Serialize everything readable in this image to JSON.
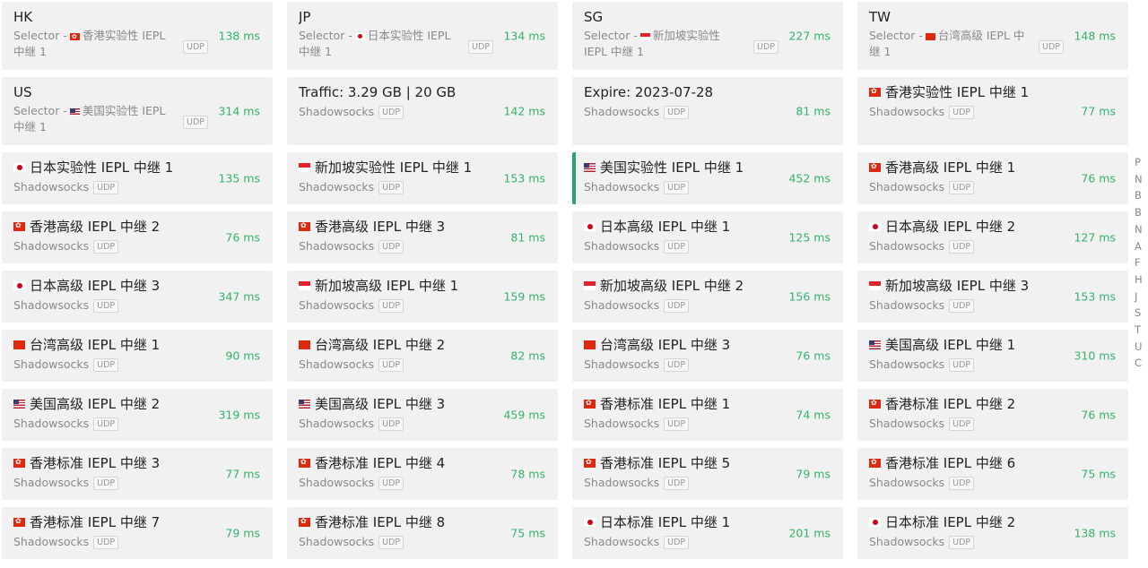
{
  "proxies": [
    {
      "kind": "selector",
      "title": "HK",
      "flag": "hk",
      "selector_prefix": "Selector -",
      "selector_value": "香港实验性 IEPL 中继 1",
      "tag": "UDP",
      "latency": "138 ms"
    },
    {
      "kind": "selector",
      "title": "JP",
      "flag": "jp",
      "selector_prefix": "Selector -",
      "selector_value": "日本实验性 IEPL 中继 1",
      "tag": "UDP",
      "latency": "134 ms"
    },
    {
      "kind": "selector",
      "title": "SG",
      "flag": "sg",
      "selector_prefix": "Selector -",
      "selector_value": "新加坡实验性 IEPL 中继 1",
      "tag": "UDP",
      "latency": "227 ms"
    },
    {
      "kind": "selector",
      "title": "TW",
      "flag": "tw",
      "selector_prefix": "Selector -",
      "selector_value": "台湾高级 IEPL 中继 1",
      "tag": "UDP",
      "latency": "148 ms"
    },
    {
      "kind": "selector",
      "title": "US",
      "flag": "us",
      "selector_prefix": "Selector -",
      "selector_value": "美国实验性 IEPL 中继 1",
      "tag": "UDP",
      "latency": "314 ms"
    },
    {
      "kind": "proxy",
      "title": "Traffic: 3.29 GB | 20 GB",
      "flag": "",
      "type": "Shadowsocks",
      "tag": "UDP",
      "latency": "142 ms"
    },
    {
      "kind": "proxy",
      "title": "Expire: 2023-07-28",
      "flag": "",
      "type": "Shadowsocks",
      "tag": "UDP",
      "latency": "81 ms"
    },
    {
      "kind": "proxy",
      "title": "香港实验性 IEPL 中继 1",
      "flag": "hk",
      "type": "Shadowsocks",
      "tag": "UDP",
      "latency": "77 ms"
    },
    {
      "kind": "proxy",
      "title": "日本实验性 IEPL 中继 1",
      "flag": "jp",
      "type": "Shadowsocks",
      "tag": "UDP",
      "latency": "135 ms"
    },
    {
      "kind": "proxy",
      "title": "新加坡实验性 IEPL 中继 1",
      "flag": "sg",
      "type": "Shadowsocks",
      "tag": "UDP",
      "latency": "153 ms"
    },
    {
      "kind": "proxy",
      "title": "美国实验性 IEPL 中继 1",
      "flag": "us",
      "type": "Shadowsocks",
      "tag": "UDP",
      "latency": "452 ms",
      "active": true
    },
    {
      "kind": "proxy",
      "title": "香港高级 IEPL 中继 1",
      "flag": "hk",
      "type": "Shadowsocks",
      "tag": "UDP",
      "latency": "76 ms"
    },
    {
      "kind": "proxy",
      "title": "香港高级 IEPL 中继 2",
      "flag": "hk",
      "type": "Shadowsocks",
      "tag": "UDP",
      "latency": "76 ms"
    },
    {
      "kind": "proxy",
      "title": "香港高级 IEPL 中继 3",
      "flag": "hk",
      "type": "Shadowsocks",
      "tag": "UDP",
      "latency": "81 ms"
    },
    {
      "kind": "proxy",
      "title": "日本高级 IEPL 中继 1",
      "flag": "jp",
      "type": "Shadowsocks",
      "tag": "UDP",
      "latency": "125 ms"
    },
    {
      "kind": "proxy",
      "title": "日本高级 IEPL 中继 2",
      "flag": "jp",
      "type": "Shadowsocks",
      "tag": "UDP",
      "latency": "127 ms"
    },
    {
      "kind": "proxy",
      "title": "日本高级 IEPL 中继 3",
      "flag": "jp",
      "type": "Shadowsocks",
      "tag": "UDP",
      "latency": "347 ms"
    },
    {
      "kind": "proxy",
      "title": "新加坡高级 IEPL 中继 1",
      "flag": "sg",
      "type": "Shadowsocks",
      "tag": "UDP",
      "latency": "159 ms"
    },
    {
      "kind": "proxy",
      "title": "新加坡高级 IEPL 中继 2",
      "flag": "sg",
      "type": "Shadowsocks",
      "tag": "UDP",
      "latency": "156 ms"
    },
    {
      "kind": "proxy",
      "title": "新加坡高级 IEPL 中继 3",
      "flag": "sg",
      "type": "Shadowsocks",
      "tag": "UDP",
      "latency": "153 ms"
    },
    {
      "kind": "proxy",
      "title": "台湾高级 IEPL 中继 1",
      "flag": "tw",
      "type": "Shadowsocks",
      "tag": "UDP",
      "latency": "90 ms"
    },
    {
      "kind": "proxy",
      "title": "台湾高级 IEPL 中继 2",
      "flag": "tw",
      "type": "Shadowsocks",
      "tag": "UDP",
      "latency": "82 ms"
    },
    {
      "kind": "proxy",
      "title": "台湾高级 IEPL 中继 3",
      "flag": "tw",
      "type": "Shadowsocks",
      "tag": "UDP",
      "latency": "76 ms"
    },
    {
      "kind": "proxy",
      "title": "美国高级 IEPL 中继 1",
      "flag": "us",
      "type": "Shadowsocks",
      "tag": "UDP",
      "latency": "310 ms"
    },
    {
      "kind": "proxy",
      "title": "美国高级 IEPL 中继 2",
      "flag": "us",
      "type": "Shadowsocks",
      "tag": "UDP",
      "latency": "319 ms"
    },
    {
      "kind": "proxy",
      "title": "美国高级 IEPL 中继 3",
      "flag": "us",
      "type": "Shadowsocks",
      "tag": "UDP",
      "latency": "459 ms"
    },
    {
      "kind": "proxy",
      "title": "香港标准 IEPL 中继 1",
      "flag": "hk",
      "type": "Shadowsocks",
      "tag": "UDP",
      "latency": "74 ms"
    },
    {
      "kind": "proxy",
      "title": "香港标准 IEPL 中继 2",
      "flag": "hk",
      "type": "Shadowsocks",
      "tag": "UDP",
      "latency": "76 ms"
    },
    {
      "kind": "proxy",
      "title": "香港标准 IEPL 中继 3",
      "flag": "hk",
      "type": "Shadowsocks",
      "tag": "UDP",
      "latency": "77 ms"
    },
    {
      "kind": "proxy",
      "title": "香港标准 IEPL 中继 4",
      "flag": "hk",
      "type": "Shadowsocks",
      "tag": "UDP",
      "latency": "78 ms"
    },
    {
      "kind": "proxy",
      "title": "香港标准 IEPL 中继 5",
      "flag": "hk",
      "type": "Shadowsocks",
      "tag": "UDP",
      "latency": "79 ms"
    },
    {
      "kind": "proxy",
      "title": "香港标准 IEPL 中继 6",
      "flag": "hk",
      "type": "Shadowsocks",
      "tag": "UDP",
      "latency": "75 ms"
    },
    {
      "kind": "proxy",
      "title": "香港标准 IEPL 中继 7",
      "flag": "hk",
      "type": "Shadowsocks",
      "tag": "UDP",
      "latency": "79 ms"
    },
    {
      "kind": "proxy",
      "title": "香港标准 IEPL 中继 8",
      "flag": "hk",
      "type": "Shadowsocks",
      "tag": "UDP",
      "latency": "75 ms"
    },
    {
      "kind": "proxy",
      "title": "日本标准 IEPL 中继 1",
      "flag": "jp",
      "type": "Shadowsocks",
      "tag": "UDP",
      "latency": "201 ms"
    },
    {
      "kind": "proxy",
      "title": "日本标准 IEPL 中继 2",
      "flag": "jp",
      "type": "Shadowsocks",
      "tag": "UDP",
      "latency": "138 ms"
    }
  ],
  "index_letters": [
    "P",
    "N",
    "B",
    "B",
    "N",
    "A",
    "F",
    "H",
    "J",
    "S",
    "T",
    "U",
    "C"
  ],
  "colors": {
    "latency": "#35b26b",
    "active": "#2ba36b",
    "card_bg": "#f1f1f1"
  }
}
